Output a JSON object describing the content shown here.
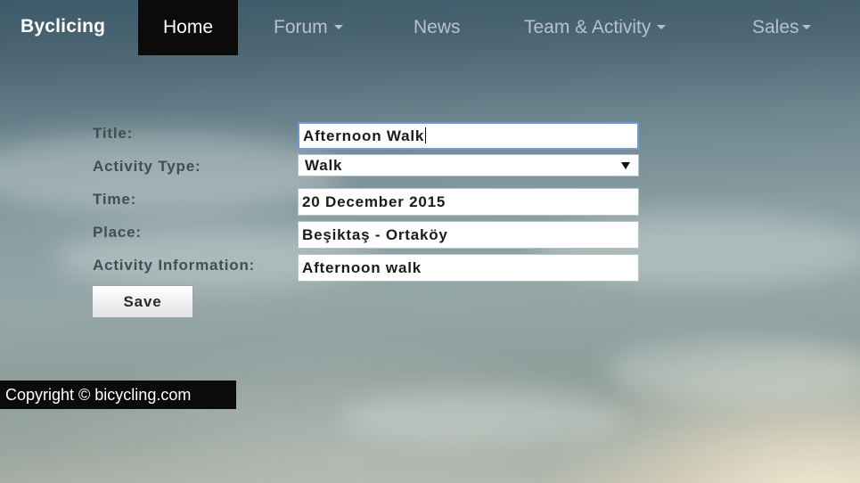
{
  "navbar": {
    "brand": "Byclicing",
    "items": [
      {
        "label": "Home",
        "active": true,
        "dropdown": false
      },
      {
        "label": "Forum",
        "active": false,
        "dropdown": true
      },
      {
        "label": "News",
        "active": false,
        "dropdown": false
      },
      {
        "label": "Team & Activity",
        "active": false,
        "dropdown": true
      },
      {
        "label": "Sales",
        "active": false,
        "dropdown": true
      }
    ]
  },
  "form": {
    "title": {
      "label": "Title:",
      "value": "Afternoon Walk"
    },
    "activity_type": {
      "label": "Activity Type:",
      "value": "Walk"
    },
    "time": {
      "label": "Time:",
      "value": "20 December 2015"
    },
    "place": {
      "label": "Place:",
      "value": "Beşiktaş - Ortaköy"
    },
    "activity_information": {
      "label": "Activity Information:",
      "value": "Afternoon walk"
    },
    "save_label": "Save"
  },
  "footer": {
    "copyright": "Copyright © bicycling.com"
  },
  "colors": {
    "navbar_active_bg": "#0b0b0b",
    "nav_text": "#b7c3c8",
    "label_text": "#3f4f55",
    "focus_border": "#6d9bd6"
  }
}
